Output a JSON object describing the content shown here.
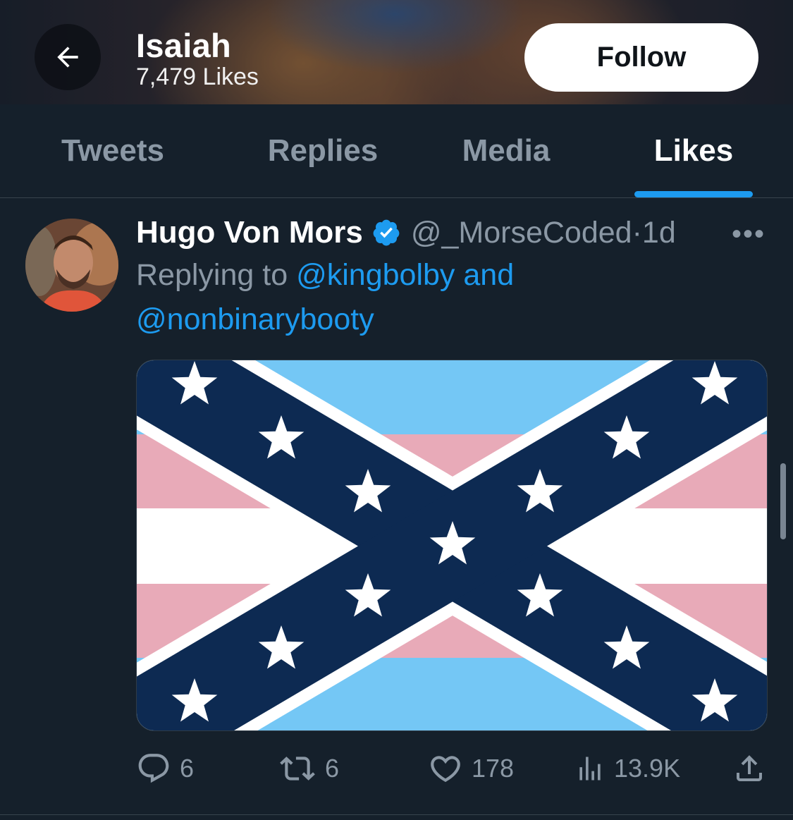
{
  "header": {
    "title": "Isaiah",
    "subtitle": "7,479 Likes",
    "follow_label": "Follow",
    "back_icon": "arrow-left-icon"
  },
  "tabs": [
    {
      "label": "Tweets",
      "active": false
    },
    {
      "label": "Replies",
      "active": false
    },
    {
      "label": "Media",
      "active": false
    },
    {
      "label": "Likes",
      "active": true
    }
  ],
  "tweet": {
    "author_name": "Hugo Von Mors",
    "verified": true,
    "handle": "@_MorseCoded",
    "separator": "·",
    "time": "1d",
    "more_label": "•••",
    "replying_prefix": "Replying to",
    "reply_to_1": "@kingbolby",
    "reply_joiner": "and",
    "reply_to_2": "@nonbinarybooty",
    "media_description_colors": {
      "light_blue": "#74c7f5",
      "pink": "#e8aab8",
      "white": "#ffffff",
      "navy": "#0d2a52"
    },
    "actions": {
      "replies": "6",
      "retweets": "6",
      "likes": "178",
      "views": "13.9K"
    }
  },
  "colors": {
    "background": "#15202b",
    "accent": "#1d9bf0",
    "muted_text": "#8b98a5"
  }
}
